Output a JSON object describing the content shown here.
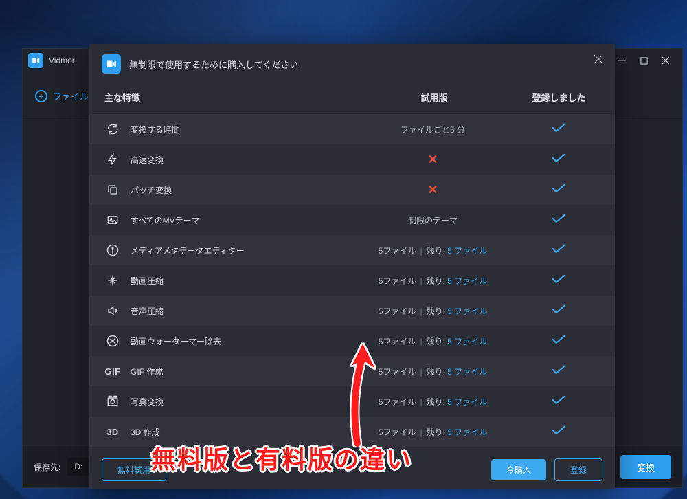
{
  "mainWindow": {
    "title": "Vidmor",
    "addFile": "ファイルを",
    "saveTo": "保存先:",
    "path": "D:",
    "convert": "変換"
  },
  "dialog": {
    "title": "無制限で使用するために購入してください",
    "columns": {
      "feature": "主な特徴",
      "trial": "試用版",
      "registered": "登録しました"
    },
    "rows": [
      {
        "icon": "refresh",
        "label": "変換する時間",
        "trial": {
          "text": "ファイルごと5 分"
        }
      },
      {
        "icon": "bolt",
        "label": "高速変換",
        "trial": {
          "x": true
        }
      },
      {
        "icon": "copy",
        "label": "バッチ変換",
        "trial": {
          "x": true
        }
      },
      {
        "icon": "image",
        "label": "すべてのMVテーマ",
        "trial": {
          "text": "制限のテーマ"
        }
      },
      {
        "icon": "info",
        "label": "メディアメタデータエディター",
        "trial": {
          "files": "5ファイル",
          "remainLabel": "残り:",
          "remainValue": "5 ファイル"
        }
      },
      {
        "icon": "compress-v",
        "label": "動画圧縮",
        "trial": {
          "files": "5ファイル",
          "remainLabel": "残り:",
          "remainValue": "5 ファイル"
        }
      },
      {
        "icon": "compress-a",
        "label": "音声圧縮",
        "trial": {
          "files": "5ファイル",
          "remainLabel": "残り:",
          "remainValue": "5 ファイル"
        }
      },
      {
        "icon": "nowm",
        "label": "動画ウォーターマー除去",
        "trial": {
          "files": "5ファイル",
          "remainLabel": "残り:",
          "remainValue": "5 ファイル"
        }
      },
      {
        "icon": "gif",
        "label": "GIF 作成",
        "trial": {
          "files": "5ファイル",
          "remainLabel": "残り:",
          "remainValue": "5 ファイル"
        }
      },
      {
        "icon": "photo",
        "label": "写真変換",
        "trial": {
          "files": "5ファイル",
          "remainLabel": "残り:",
          "remainValue": "5 ファイル"
        }
      },
      {
        "icon": "3d",
        "label": "3D 作成",
        "trial": {
          "files": "5ファイル",
          "remainLabel": "残り:",
          "remainValue": "5 ファイル"
        }
      }
    ],
    "buttons": {
      "trial": "無料試用",
      "purchase": "今購入",
      "register": "登録"
    }
  },
  "annotation": "無料版と有料版の違い"
}
